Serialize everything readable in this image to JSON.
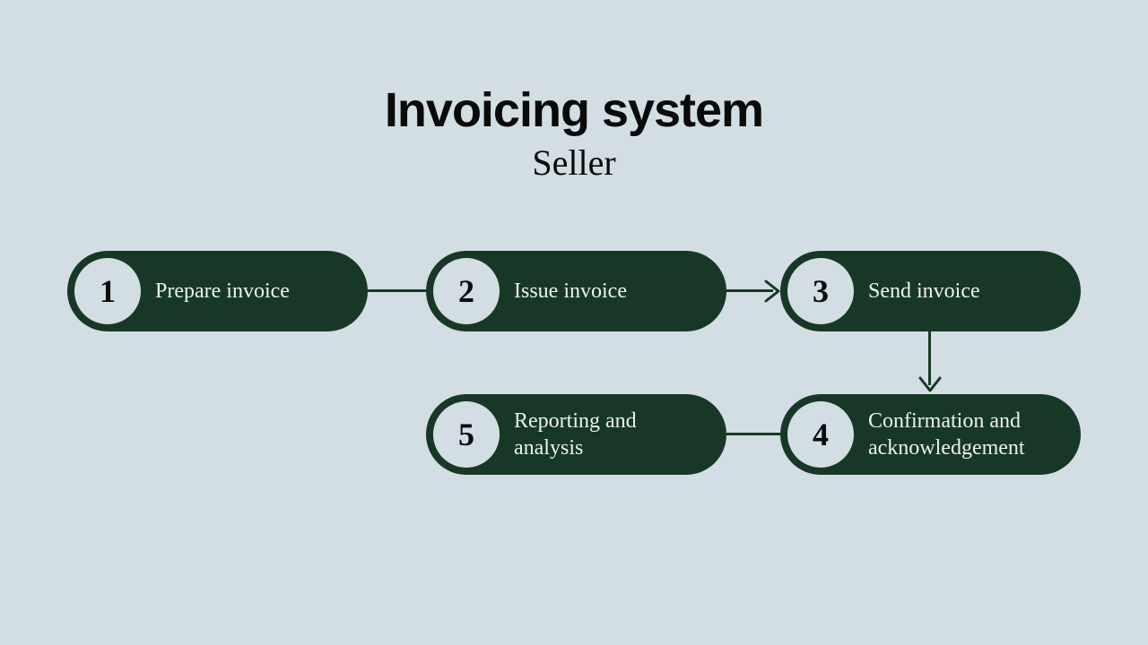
{
  "title": "Invoicing system",
  "subtitle": "Seller",
  "colors": {
    "background": "#d2dee3",
    "pill": "#173826",
    "circle": "#d2dee3",
    "text_dark": "#0a0a0a",
    "text_light": "#edf2f0"
  },
  "steps": [
    {
      "num": "1",
      "label": "Prepare invoice"
    },
    {
      "num": "2",
      "label": "Issue invoice"
    },
    {
      "num": "3",
      "label": "Send invoice"
    },
    {
      "num": "4",
      "label": "Confirmation and acknowledgement"
    },
    {
      "num": "5",
      "label": "Reporting and analysis"
    }
  ],
  "flow": [
    {
      "from": 1,
      "to": 2,
      "style": "line"
    },
    {
      "from": 2,
      "to": 3,
      "style": "arrow"
    },
    {
      "from": 3,
      "to": 4,
      "style": "arrow"
    },
    {
      "from": 4,
      "to": 5,
      "style": "line"
    }
  ]
}
